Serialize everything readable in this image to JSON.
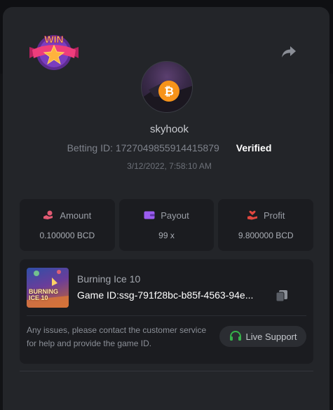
{
  "badge": {
    "label": "WIN"
  },
  "user": {
    "name": "skyhook",
    "betting_id": "Betting ID: 1727049855914415879",
    "verified": "Verified",
    "timestamp": "3/12/2022, 7:58:10 AM"
  },
  "stats": [
    {
      "icon": "hand-coins-icon",
      "label": "Amount",
      "value": "0.100000 BCD",
      "color": "#e25a73"
    },
    {
      "icon": "wallet-icon",
      "label": "Payout",
      "value": "99 x",
      "color": "#9b5cf0"
    },
    {
      "icon": "hand-heart-icon",
      "label": "Profit",
      "value": "9.800000 BCD",
      "color": "#e2473f"
    }
  ],
  "game": {
    "title": "Burning Ice 10",
    "id": "Game ID:ssg-791f28bc-b85f-4563-94e...",
    "thumb_text": "BURNING\nICE 10"
  },
  "support": {
    "message": "Any issues, please contact the customer service for help and provide the game ID.",
    "button_label": "Live Support",
    "button_icon_color": "#36b24a"
  }
}
